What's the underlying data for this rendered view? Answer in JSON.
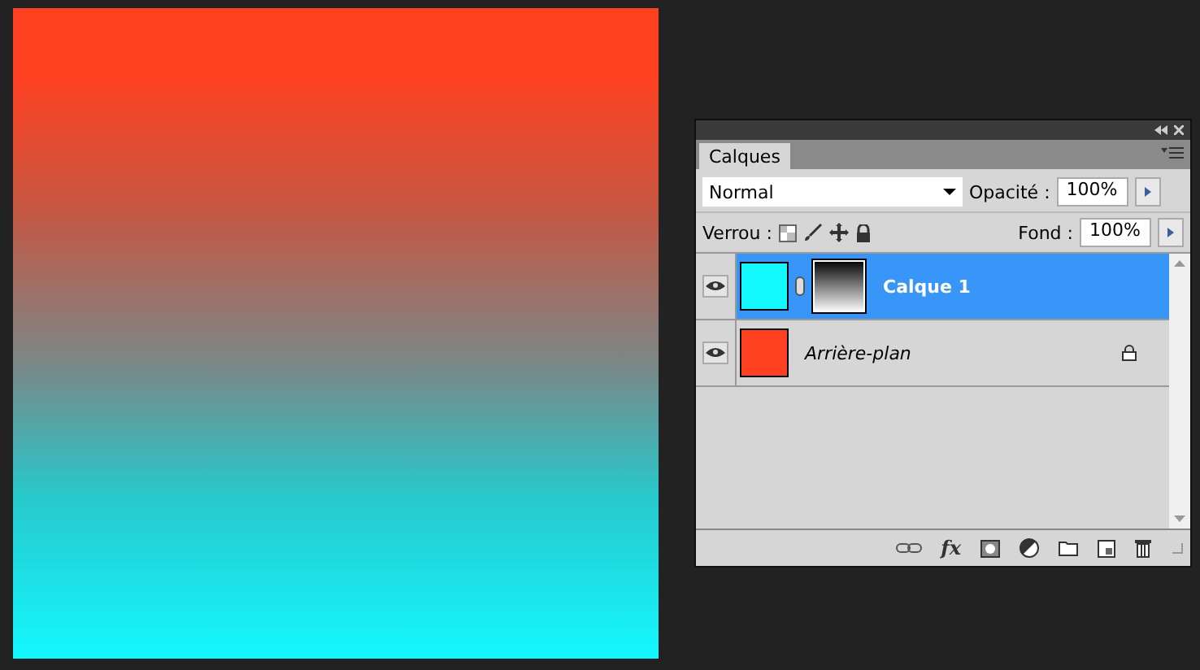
{
  "canvas": {
    "kind": "gradient"
  },
  "panel": {
    "tabs": [
      {
        "label": "Calques",
        "selected": true
      }
    ],
    "blend_mode": "Normal",
    "opacity_label": "Opacité :",
    "opacity": "100%",
    "lock_label": "Verrou :",
    "fill_label": "Fond :",
    "fill": "100%",
    "layers": [
      {
        "name": "Calque 1",
        "selected": true,
        "visible": true,
        "color": "#12f8ff",
        "kind": "masked",
        "locked": false
      },
      {
        "name": "Arrière-plan",
        "selected": false,
        "visible": true,
        "color": "#ff4020",
        "kind": "background",
        "locked": true
      }
    ],
    "fx_label": "fx"
  }
}
